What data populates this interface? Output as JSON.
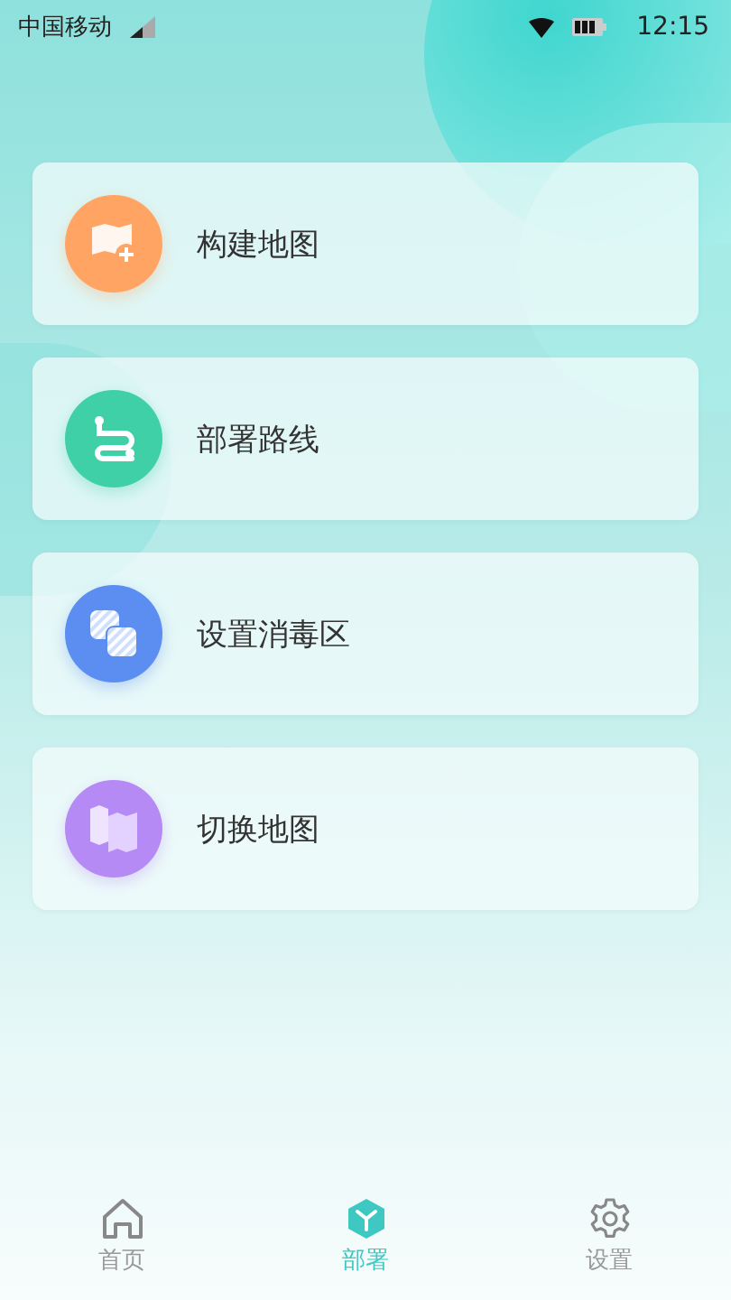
{
  "status_bar": {
    "carrier": "中国移动",
    "time": "12:15"
  },
  "menu": [
    {
      "label": "构建地图",
      "kind": "map-plus",
      "color": "#ffa463"
    },
    {
      "label": "部署路线",
      "kind": "route",
      "color": "#3fd0a8"
    },
    {
      "label": "设置消毒区",
      "kind": "zones",
      "color": "#5b8ef0"
    },
    {
      "label": "切换地图",
      "kind": "maps",
      "color": "#b68af5"
    }
  ],
  "tab_bar": [
    {
      "label": "首页",
      "kind": "home",
      "selected": false
    },
    {
      "label": "部署",
      "kind": "cube",
      "selected": true
    },
    {
      "label": "设置",
      "kind": "gear",
      "selected": false
    }
  ]
}
